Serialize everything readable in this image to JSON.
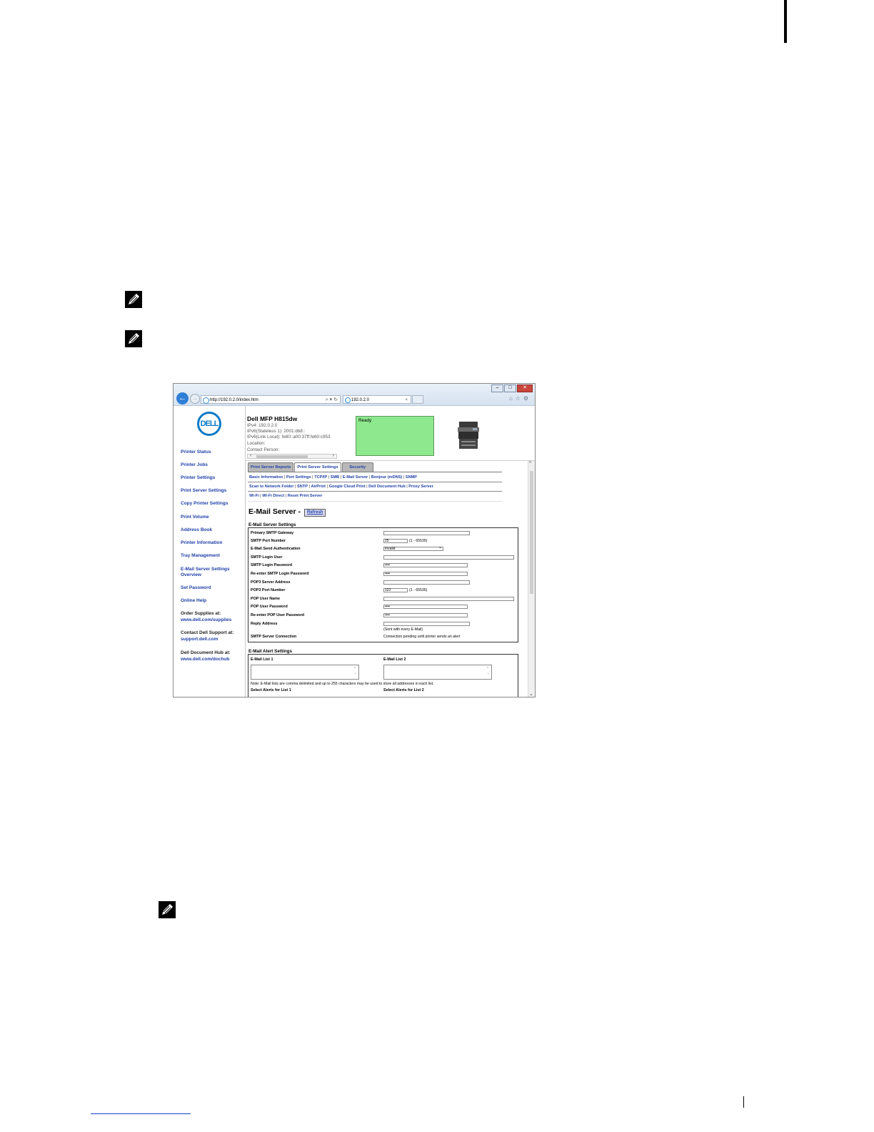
{
  "browser": {
    "address": "http://192.0.2.0/index.htm",
    "address_host": "192.0.2.0",
    "tab_title": "192.0.2.0"
  },
  "sidebar": {
    "logo_text": "DELL",
    "items": [
      "Printer Status",
      "Printer Jobs",
      "Printer Settings",
      "Print Server Settings",
      "Copy Printer Settings",
      "Print Volume",
      "Address Book",
      "Printer Information",
      "Tray Management",
      "E-Mail Server Settings",
      "Overview",
      "Set Password",
      "Online Help"
    ],
    "order_label": "Order Supplies at:",
    "order_link": "www.dell.com/supplies",
    "support_label": "Contact Dell Support at:",
    "support_link": "support.dell.com",
    "dochub_label": "Dell Document Hub at:",
    "dochub_link": "www.dell.com/dochub"
  },
  "header": {
    "printer_name": "Dell MFP H815dw",
    "ipv4": "IPv4: 192.0.2.0",
    "ipv6_stateless": "IPv6(Stateless 1): 2001:db8::",
    "ipv6_link": "IPv6(Link Local): fe80::a00:37ff:fe60:c953",
    "location": "Location:",
    "contact": "Contact Person:",
    "status": "Ready"
  },
  "tabs": [
    "Print Server Reports",
    "Print Server Settings",
    "Security"
  ],
  "links": {
    "row1": [
      "Basic Information",
      "Port Settings",
      "TCP/IP",
      "SMB",
      "E-Mail Server",
      "Bonjour (mDNS)",
      "SNMP"
    ],
    "row2": [
      "Scan to Network Folder",
      "SNTP",
      "AirPrint",
      "Google Cloud Print",
      "Dell Document Hub",
      "Proxy Server"
    ],
    "row3": [
      "Wi-Fi",
      "Wi-Fi Direct",
      "Reset Print Server"
    ]
  },
  "page": {
    "title": "E-Mail Server -",
    "refresh": "Refresh"
  },
  "email_server": {
    "section_title": "E-Mail Server Settings",
    "labels": {
      "primary_gateway": "Primary SMTP Gateway",
      "smtp_port": "SMTP Port Number",
      "send_auth": "E-Mail Send Authentication",
      "login_user": "SMTP Login User",
      "login_password": "SMTP Login Password",
      "reenter_login_password": "Re-enter SMTP Login Password",
      "pop3_address": "POP3 Server Address",
      "pop3_port": "POP3 Port Number",
      "pop_user": "POP User Name",
      "pop_password": "POP User Password",
      "reenter_pop_password": "Re-enter POP User Password",
      "reply_address": "Reply Address",
      "smtp_connection": "SMTP Server Connection"
    },
    "values": {
      "primary_gateway": "",
      "smtp_port": "25",
      "smtp_port_range": "(1 - 65535)",
      "send_auth": "Invalid",
      "login_user": "",
      "login_password": "••••",
      "reenter_login_password": "••••",
      "pop3_address": "",
      "pop3_port": "110",
      "pop3_port_range": "(1 - 65535)",
      "pop_user": "",
      "pop_password": "••••",
      "reenter_pop_password": "••••",
      "reply_address": "",
      "reply_note": "(Sent with every E-Mail)",
      "smtp_connection": "Connection pending until printer sends an alert"
    }
  },
  "alerts": {
    "section_title": "E-Mail Alert Settings",
    "list1_label": "E-Mail List 1",
    "list2_label": "E-Mail List 2",
    "note": "Note: E-Mail lists are comma delimited and up to 255 characters may be used to store all addresses in each list.",
    "select1": "Select Alerts for List 1",
    "select2": "Select Alerts for List 2"
  }
}
